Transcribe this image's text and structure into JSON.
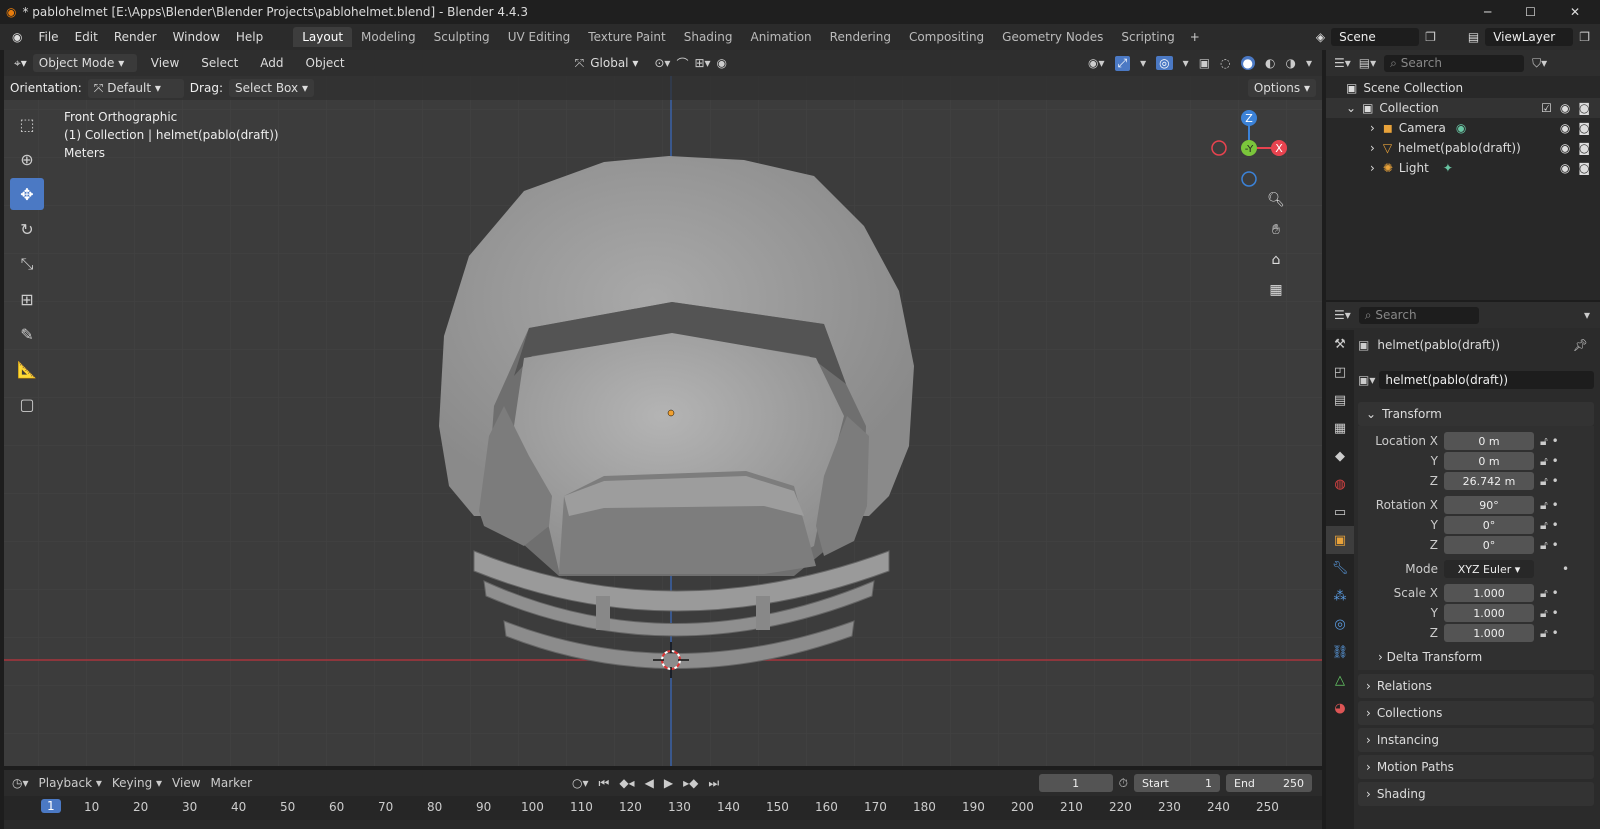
{
  "window": {
    "title": "* pablohelmet [E:\\Apps\\Blender\\Blender Projects\\pablohelmet.blend] - Blender 4.4.3"
  },
  "menus": [
    "File",
    "Edit",
    "Render",
    "Window",
    "Help"
  ],
  "workspaces": [
    "Layout",
    "Modeling",
    "Sculpting",
    "UV Editing",
    "Texture Paint",
    "Shading",
    "Animation",
    "Rendering",
    "Compositing",
    "Geometry Nodes",
    "Scripting"
  ],
  "active_workspace": "Layout",
  "scene": {
    "name": "Scene",
    "view_layer": "ViewLayer"
  },
  "viewport_header": {
    "mode": "Object Mode",
    "menus": [
      "View",
      "Select",
      "Add",
      "Object"
    ],
    "transform_orientation": "Global"
  },
  "tool_header": {
    "orientation_label": "Orientation:",
    "orientation_value": "Default",
    "drag_label": "Drag:",
    "drag_value": "Select Box",
    "options_label": "Options"
  },
  "viewport": {
    "view_name": "Front Orthographic",
    "context": "(1) Collection | helmet(pablo(draft))",
    "units": "Meters",
    "axes": {
      "z": "Z",
      "y": "-Y",
      "x": "X"
    }
  },
  "outliner": {
    "search_placeholder": "Search",
    "items": [
      {
        "label": "Scene Collection"
      },
      {
        "label": "Collection"
      },
      {
        "label": "Camera"
      },
      {
        "label": "helmet(pablo(draft))"
      },
      {
        "label": "Light"
      }
    ]
  },
  "properties": {
    "search_placeholder": "Search",
    "object_name": "helmet(pablo(draft))",
    "object_field": "helmet(pablo(draft))",
    "transform_label": "Transform",
    "location": {
      "label_x": "Location X",
      "label_y": "Y",
      "label_z": "Z",
      "x": "0 m",
      "y": "0 m",
      "z": "26.742 m"
    },
    "rotation": {
      "label_x": "Rotation X",
      "label_y": "Y",
      "label_z": "Z",
      "x": "90°",
      "y": "0°",
      "z": "0°"
    },
    "mode": {
      "label": "Mode",
      "value": "XYZ Euler"
    },
    "scale": {
      "label_x": "Scale X",
      "label_y": "Y",
      "label_z": "Z",
      "x": "1.000",
      "y": "1.000",
      "z": "1.000"
    },
    "delta": "Delta Transform",
    "panels": [
      "Relations",
      "Collections",
      "Instancing",
      "Motion Paths",
      "Shading"
    ]
  },
  "timeline": {
    "menus": [
      "Playback",
      "Keying",
      "View",
      "Marker"
    ],
    "current_frame": "1",
    "start_label": "Start",
    "start": "1",
    "end_label": "End",
    "end": "250",
    "ticks": [
      "1",
      "10",
      "20",
      "30",
      "40",
      "50",
      "60",
      "70",
      "80",
      "90",
      "100",
      "110",
      "120",
      "130",
      "140",
      "150",
      "160",
      "170",
      "180",
      "190",
      "200",
      "210",
      "220",
      "230",
      "240",
      "250"
    ]
  },
  "colors": {
    "accent": "#4b79c4",
    "x_axis": "#e8434f",
    "y_axis": "#7bc63b",
    "z_axis": "#3b82d8"
  }
}
